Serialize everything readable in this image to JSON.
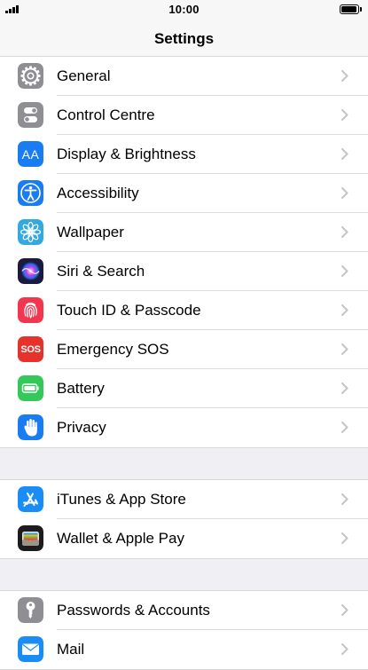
{
  "status_bar": {
    "time": "10:00"
  },
  "nav": {
    "title": "Settings"
  },
  "groups": [
    {
      "items": [
        {
          "label": "General",
          "icon": "gear-icon",
          "color": "#8e8e93"
        },
        {
          "label": "Control Centre",
          "icon": "toggles-icon",
          "color": "#8e8e93"
        },
        {
          "label": "Display & Brightness",
          "icon": "text-size-icon",
          "color": "#1a7cf2",
          "icon_text": "AA"
        },
        {
          "label": "Accessibility",
          "icon": "accessibility-icon",
          "color": "#1a7cf2"
        },
        {
          "label": "Wallpaper",
          "icon": "flower-icon",
          "color": "#32a9e0"
        },
        {
          "label": "Siri & Search",
          "icon": "siri-icon",
          "color": "#1b1a40"
        },
        {
          "label": "Touch ID & Passcode",
          "icon": "fingerprint-icon",
          "color": "#f2364f"
        },
        {
          "label": "Emergency SOS",
          "icon": "sos-icon",
          "color": "#e5322b",
          "icon_text": "SOS"
        },
        {
          "label": "Battery",
          "icon": "battery-icon",
          "color": "#34c759"
        },
        {
          "label": "Privacy",
          "icon": "hand-icon",
          "color": "#1a7cf2"
        }
      ]
    },
    {
      "items": [
        {
          "label": "iTunes & App Store",
          "icon": "app-store-icon",
          "color": "#1a8cf6"
        },
        {
          "label": "Wallet & Apple Pay",
          "icon": "wallet-icon",
          "color": "#1c1c1e"
        }
      ]
    },
    {
      "items": [
        {
          "label": "Passwords & Accounts",
          "icon": "key-icon",
          "color": "#8e8e93"
        },
        {
          "label": "Mail",
          "icon": "mail-icon",
          "color": "#1a8cf6"
        }
      ]
    }
  ]
}
